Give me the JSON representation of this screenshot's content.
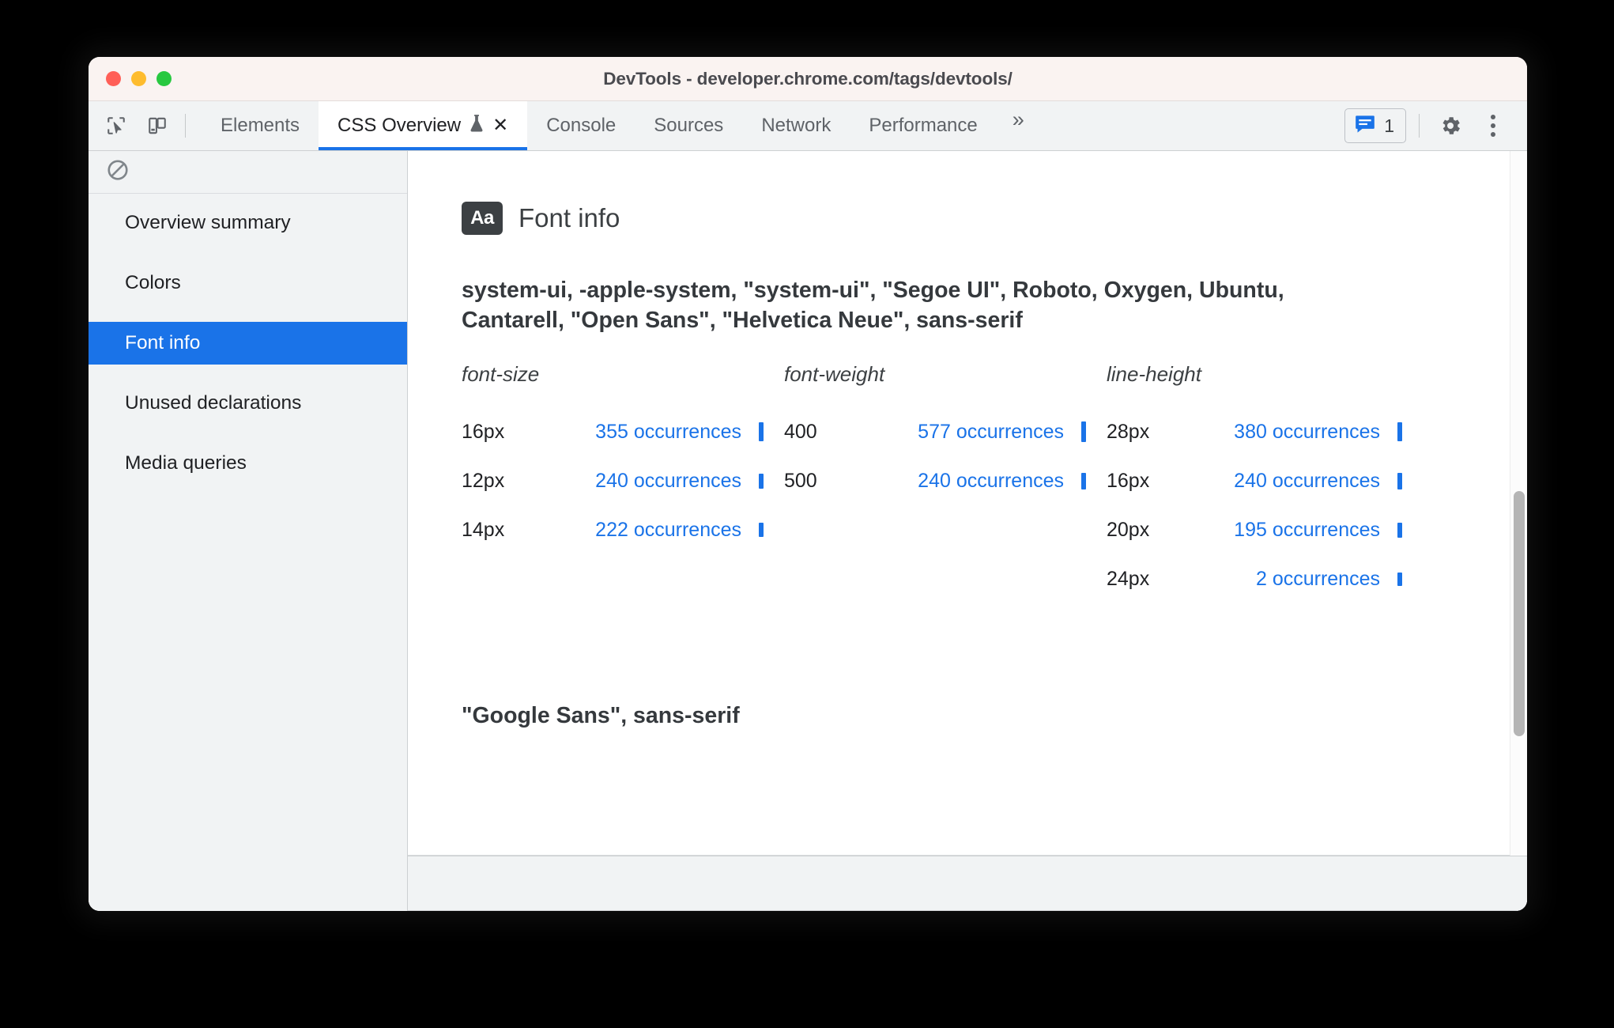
{
  "window": {
    "title": "DevTools - developer.chrome.com/tags/devtools/",
    "traffic_lights": [
      "close",
      "minimize",
      "zoom"
    ]
  },
  "toolbar": {
    "inspect_icon": "inspect-cursor-icon",
    "device_icon": "device-toolbar-icon",
    "overflow_label": "»",
    "issues": {
      "icon": "issues-message-icon",
      "count": "1"
    },
    "settings_icon": "gear-icon",
    "more_icon": "kebab-menu-icon",
    "tabs": [
      {
        "label": "Elements",
        "active": false
      },
      {
        "label": "CSS Overview",
        "active": true,
        "experimental_icon": "flask-icon",
        "close_label": "✕"
      },
      {
        "label": "Console",
        "active": false
      },
      {
        "label": "Sources",
        "active": false
      },
      {
        "label": "Network",
        "active": false
      },
      {
        "label": "Performance",
        "active": false
      }
    ]
  },
  "sidebar": {
    "clear_icon": "no-entry-clear-icon",
    "items": [
      {
        "label": "Overview summary",
        "selected": false
      },
      {
        "label": "Colors",
        "selected": false
      },
      {
        "label": "Font info",
        "selected": true
      },
      {
        "label": "Unused declarations",
        "selected": false
      },
      {
        "label": "Media queries",
        "selected": false
      }
    ]
  },
  "main": {
    "badge_label": "Aa",
    "section_title": "Font info",
    "font_families": [
      "system-ui, -apple-system, \"system-ui\", \"Segoe UI\", Roboto, Oxygen, Ubuntu, Cantarell, \"Open Sans\", \"Helvetica Neue\", sans-serif",
      "\"Google Sans\", sans-serif"
    ],
    "columns": [
      {
        "header": "font-size",
        "rows": [
          {
            "key": "16px",
            "value": "355 occurrences",
            "count": 355
          },
          {
            "key": "12px",
            "value": "240 occurrences",
            "count": 240
          },
          {
            "key": "14px",
            "value": "222 occurrences",
            "count": 222
          }
        ]
      },
      {
        "header": "font-weight",
        "rows": [
          {
            "key": "400",
            "value": "577 occurrences",
            "count": 577
          },
          {
            "key": "500",
            "value": "240 occurrences",
            "count": 240
          }
        ]
      },
      {
        "header": "line-height",
        "rows": [
          {
            "key": "28px",
            "value": "380 occurrences",
            "count": 380
          },
          {
            "key": "16px",
            "value": "240 occurrences",
            "count": 240
          },
          {
            "key": "20px",
            "value": "195 occurrences",
            "count": 195
          },
          {
            "key": "24px",
            "value": "2 occurrences",
            "count": 2
          }
        ]
      }
    ]
  },
  "colors": {
    "accent": "#1a73e8",
    "link": "#1a73e8",
    "titlebar_bg": "#faf3f1",
    "toolbar_bg": "#f1f3f4",
    "text": "#202124",
    "muted_text": "#5f6368",
    "badge_bg": "#3c4043"
  },
  "scrollbar": {
    "thumb_top_pct": 40,
    "thumb_height_pct": 29
  }
}
